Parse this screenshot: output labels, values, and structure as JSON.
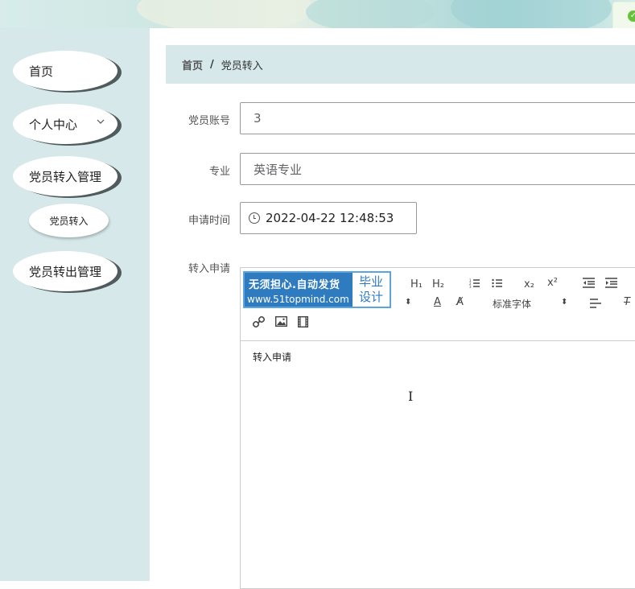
{
  "breadcrumb": {
    "home": "首页",
    "separator": "/",
    "current": "党员转入"
  },
  "sidebar": {
    "items": [
      {
        "label": "首页"
      },
      {
        "label": "个人中心",
        "icon": "chevron-down-icon"
      },
      {
        "label": "党员转入管理"
      },
      {
        "label": "党员转出管理"
      }
    ],
    "sub_item": {
      "label": "党员转入"
    }
  },
  "form": {
    "account_label": "党员账号",
    "account_value": "3",
    "major_label": "专业",
    "major_value": "英语专业",
    "apply_time_label": "申请时间",
    "apply_time_value": "2022-04-22 12:48:53",
    "application_label": "转入申请"
  },
  "editor": {
    "content": "转入申请",
    "font_select": "标准字体",
    "toolbar": {
      "h1": "H₁",
      "h2": "H₂",
      "sub": "x₂",
      "sup": "x²"
    }
  },
  "watermark": {
    "line1": "无须担心.自动发货",
    "line2": "www.51topmind.com",
    "badge_line1": "毕业",
    "badge_line2": "设计"
  },
  "colors": {
    "sidebar_bg": "#d6e8ea",
    "accent": "#2e7bc0",
    "success": "#67c23a"
  }
}
